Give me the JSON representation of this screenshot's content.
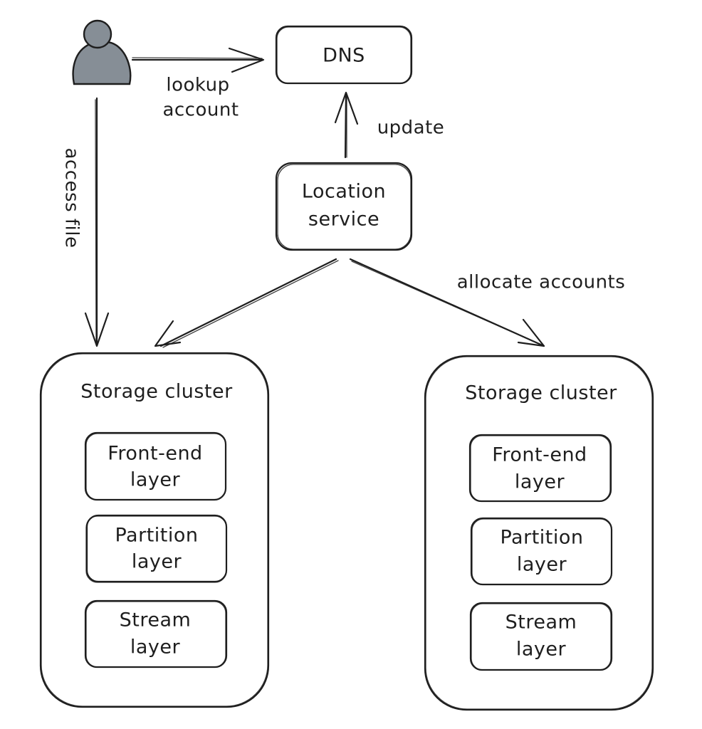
{
  "diagram": {
    "actor": {
      "icon": "user-icon",
      "color": "#868e96"
    },
    "nodes": {
      "dns": {
        "label": "DNS"
      },
      "location_service": {
        "lines": [
          "Location",
          "service"
        ]
      },
      "clusters": [
        {
          "title": "Storage cluster",
          "layers": [
            {
              "lines": [
                "Front-end",
                "layer"
              ]
            },
            {
              "lines": [
                "Partition",
                "layer"
              ]
            },
            {
              "lines": [
                "Stream",
                "layer"
              ]
            }
          ]
        },
        {
          "title": "Storage cluster",
          "layers": [
            {
              "lines": [
                "Front-end",
                "layer"
              ]
            },
            {
              "lines": [
                "Partition",
                "layer"
              ]
            },
            {
              "lines": [
                "Stream",
                "layer"
              ]
            }
          ]
        }
      ]
    },
    "edges": {
      "lookup": {
        "from": "user",
        "to": "DNS",
        "lines": [
          "lookup",
          "account"
        ]
      },
      "access": {
        "from": "user",
        "to": "Storage cluster (left)",
        "label": "access file"
      },
      "update": {
        "from": "Location service",
        "to": "DNS",
        "label": "update"
      },
      "allocate": {
        "from": "Location service",
        "to": "Storage clusters",
        "label": "allocate accounts"
      }
    }
  }
}
